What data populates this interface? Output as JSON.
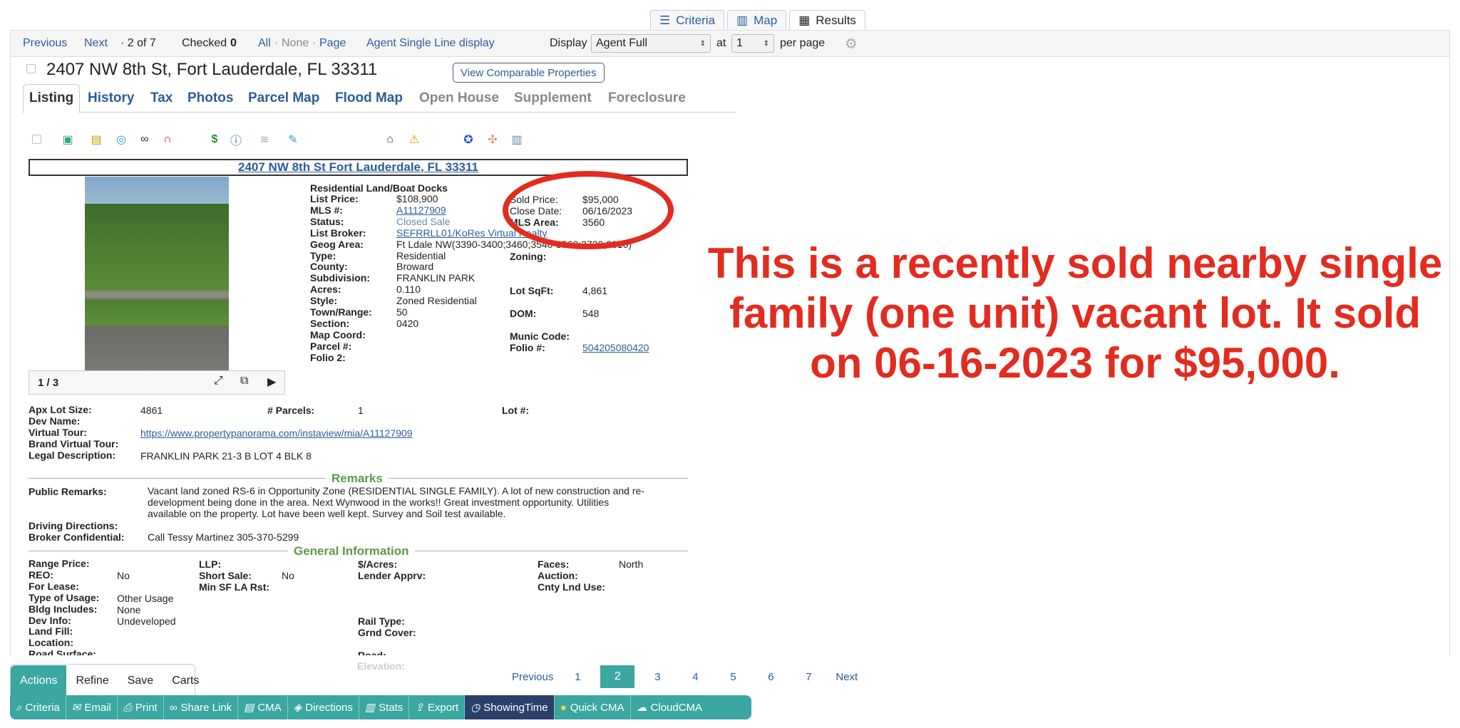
{
  "top_tabs": [
    {
      "label": "Criteria",
      "icon": "sliders-icon"
    },
    {
      "label": "Map",
      "icon": "map-icon"
    },
    {
      "label": "Results",
      "icon": "table-icon"
    }
  ],
  "nav": {
    "previous": "Previous",
    "next": "Next",
    "position": "· 2 of 7",
    "checked_label": "Checked",
    "checked_count": "0",
    "all": "All",
    "sep1": "·",
    "none": "None",
    "sep2": "·",
    "page": "Page",
    "agent_single_line": "Agent Single Line display",
    "display_label": "Display",
    "display_value": "Agent Full",
    "at_label": "at",
    "per_page_value": "1",
    "per_page_label": "per page"
  },
  "listing": {
    "address_title": "2407 NW 8th St, Fort Lauderdale, FL 33311",
    "view_comparable": "View Comparable Properties",
    "subtabs": [
      "Listing",
      "History",
      "Tax",
      "Photos",
      "Parcel Map",
      "Flood Map",
      "Open House",
      "Supplement",
      "Foreclosure"
    ],
    "banner_address": "2407 NW 8th St Fort Lauderdale, FL 33311",
    "photo_counter": "1 / 3",
    "property_type": "Residential Land/Boat Docks",
    "left_fields": [
      {
        "k": "List Price:",
        "v": "$108,900"
      },
      {
        "k": "MLS #:",
        "v": "A11127909"
      },
      {
        "k": "Status:",
        "v": "Closed Sale"
      },
      {
        "k": "List Broker:",
        "v": "SEFRRLL01/KoRes Virtual Realty"
      },
      {
        "k": "Geog Area:",
        "v": "Ft Ldale NW(3390-3400;3460;3540-3560;3720;3810)"
      },
      {
        "k": "Type:",
        "v": "Residential"
      },
      {
        "k": "County:",
        "v": "Broward"
      },
      {
        "k": "Subdivision:",
        "v": "FRANKLIN PARK"
      },
      {
        "k": "Acres:",
        "v": "0.110"
      },
      {
        "k": "Style:",
        "v": "Zoned Residential"
      },
      {
        "k": "Town/Range:",
        "v": "50"
      },
      {
        "k": "Section:",
        "v": ""
      },
      {
        "k": "Map Coord:",
        "v": ""
      },
      {
        "k": "Parcel #:",
        "v": "0420"
      },
      {
        "k": "Folio 2:",
        "v": ""
      }
    ],
    "sold_price_label": "Sold Price:",
    "sold_price": "$95,000",
    "close_date_label": "Close Date:",
    "close_date": "06/16/2023",
    "mls_area_label": "MLS Area:",
    "mls_area": "3560",
    "zoning_label": "Zoning:",
    "lot_sqft_label": "Lot SqFt:",
    "lot_sqft": "4,861",
    "dom_label": "DOM:",
    "dom": "548",
    "munic_label": "Munic Code:",
    "folio_label": "Folio #:",
    "folio": "504205080420",
    "apx_lot_label": "Apx Lot Size:",
    "apx_lot": "4861",
    "parcels_label": "# Parcels:",
    "parcels": "1",
    "lot_num_label": "Lot #:",
    "dev_name_label": "Dev Name:",
    "virtual_tour_label": "Virtual Tour:",
    "virtual_tour": "https://www.propertypanorama.com/instaview/mia/A11127909",
    "brand_tour_label": "Brand Virtual Tour:",
    "legal_label": "Legal Description:",
    "legal": "FRANKLIN PARK 21-3 B LOT 4 BLK 8",
    "remarks_heading": "Remarks",
    "public_remarks_label": "Public Remarks:",
    "public_remarks_lines": [
      "Vacant land zoned RS-6 in Opportunity Zone (RESIDENTIAL SINGLE FAMILY). A lot of new construction and re-",
      "development being done in the area. Next Wynwood in the works!! Great investment opportunity. Utilities",
      "available on the property. Lot have been well kept. Survey and Soil test available."
    ],
    "driving_label": "Driving Directions:",
    "broker_conf_label": "Broker Confidential:",
    "broker_conf": "Call Tessy Martinez 305-370-5299",
    "general_heading": "General Information",
    "gen": {
      "range_price": "Range Price:",
      "llp": "LLP:",
      "per_acre": "$/Acres:",
      "faces": "Faces:",
      "faces_v": "North",
      "reo": "REO:",
      "reo_v": "No",
      "short_sale": "Short Sale:",
      "short_sale_v": "No",
      "lender": "Lender Apprv:",
      "auction": "Auction:",
      "for_lease": "For Lease:",
      "min_sf": "Min SF LA Rst:",
      "cnty": "Cnty Lnd Use:",
      "usage": "Type of Usage:",
      "usage_v": "Other Usage",
      "bldg": "Bldg Includes:",
      "bldg_v": "None",
      "dev_info": "Dev Info:",
      "dev_info_v": "Undeveloped",
      "rail": "Rail Type:",
      "land_fill": "Land Fill:",
      "grnd": "Grnd Cover:",
      "location": "Location:",
      "road_surface": "Road Surface:",
      "road": "Road:",
      "elevation": "Elevation:"
    }
  },
  "annotation": "This is a recently sold nearby single family (one unit) vacant lot. It sold on 06-16-2023 for $95,000.",
  "bottom_tabs": [
    "Actions",
    "Refine",
    "Save",
    "Carts"
  ],
  "pager": {
    "previous": "Previous",
    "pages": [
      "1",
      "2",
      "3",
      "4",
      "5",
      "6",
      "7"
    ],
    "current": "2",
    "next": "Next"
  },
  "actions": [
    {
      "label": "Criteria",
      "icon": "search-icon"
    },
    {
      "label": "Email",
      "icon": "email-icon"
    },
    {
      "label": "Print",
      "icon": "print-icon"
    },
    {
      "label": "Share Link",
      "icon": "link-icon"
    },
    {
      "label": "CMA",
      "icon": "document-icon"
    },
    {
      "label": "Directions",
      "icon": "compass-icon"
    },
    {
      "label": "Stats",
      "icon": "stats-icon"
    },
    {
      "label": "Export",
      "icon": "export-icon"
    },
    {
      "label": "ShowingTime",
      "icon": "showingtime-icon"
    },
    {
      "label": "Quick CMA",
      "icon": "quick-cma-icon"
    },
    {
      "label": "CloudCMA",
      "icon": "cloud-icon"
    }
  ],
  "colors": {
    "link": "#2a5d9a",
    "accent_teal": "#3aa7a0",
    "annotation_red": "#e32b1f",
    "section_green": "#5a9a4a"
  }
}
